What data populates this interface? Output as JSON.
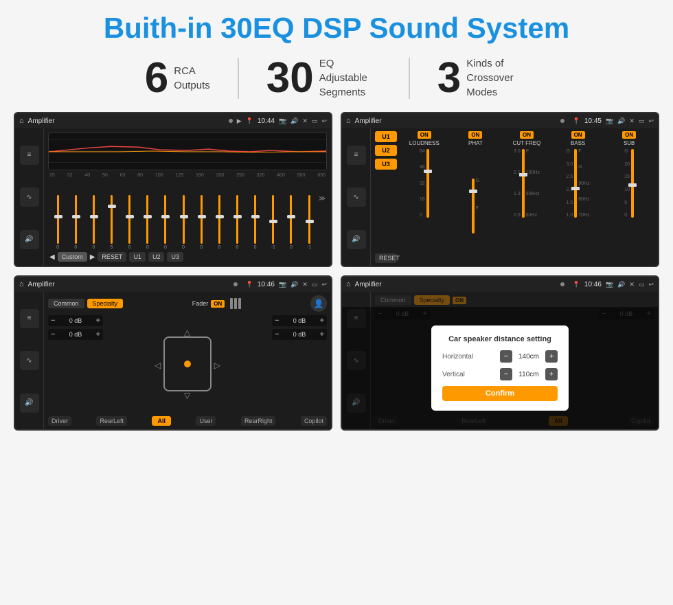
{
  "page": {
    "title": "Buith-in 30EQ DSP Sound System",
    "stats": [
      {
        "number": "6",
        "label": "RCA\nOutputs"
      },
      {
        "number": "30",
        "label": "EQ Adjustable\nSegments"
      },
      {
        "number": "3",
        "label": "Kinds of\nCrossover Modes"
      }
    ]
  },
  "screens": {
    "eq": {
      "topbar": {
        "title": "Amplifier",
        "time": "10:44"
      },
      "freq_labels": [
        "25",
        "32",
        "40",
        "50",
        "63",
        "80",
        "100",
        "125",
        "160",
        "200",
        "250",
        "320",
        "400",
        "500",
        "630"
      ],
      "slider_values": [
        "0",
        "0",
        "0",
        "5",
        "0",
        "0",
        "0",
        "0",
        "0",
        "0",
        "0",
        "0",
        "-1",
        "0",
        "-1"
      ],
      "bottom_btns": [
        "Custom",
        "RESET",
        "U1",
        "U2",
        "U3"
      ]
    },
    "crossover": {
      "topbar": {
        "title": "Amplifier",
        "time": "10:45"
      },
      "presets": [
        "U1",
        "U2",
        "U3"
      ],
      "channels": [
        {
          "name": "LOUDNESS",
          "on": true
        },
        {
          "name": "PHAT",
          "on": true
        },
        {
          "name": "CUT FREQ",
          "on": true
        },
        {
          "name": "BASS",
          "on": true
        },
        {
          "name": "SUB",
          "on": true
        }
      ],
      "reset_label": "RESET"
    },
    "fader": {
      "topbar": {
        "title": "Amplifier",
        "time": "10:46"
      },
      "tabs": [
        "Common",
        "Specialty"
      ],
      "active_tab": "Specialty",
      "fader_label": "Fader",
      "on_label": "ON",
      "db_values": [
        "0 dB",
        "0 dB",
        "0 dB",
        "0 dB"
      ],
      "bottom_labels": [
        "Driver",
        "RearLeft",
        "All",
        "User",
        "RearRight",
        "Copilot"
      ]
    },
    "distance": {
      "topbar": {
        "title": "Amplifier",
        "time": "10:46"
      },
      "tabs": [
        "Common",
        "Specialty"
      ],
      "active_tab": "Specialty",
      "dialog": {
        "title": "Car speaker distance setting",
        "horizontal_label": "Horizontal",
        "horizontal_value": "140cm",
        "vertical_label": "Vertical",
        "vertical_value": "110cm",
        "confirm_label": "Confirm"
      },
      "db_values": [
        "0 dB",
        "0 dB"
      ],
      "bottom_labels": [
        "Driver",
        "RearLeft",
        "All",
        "User",
        "RearRight",
        "Copilot"
      ]
    }
  }
}
